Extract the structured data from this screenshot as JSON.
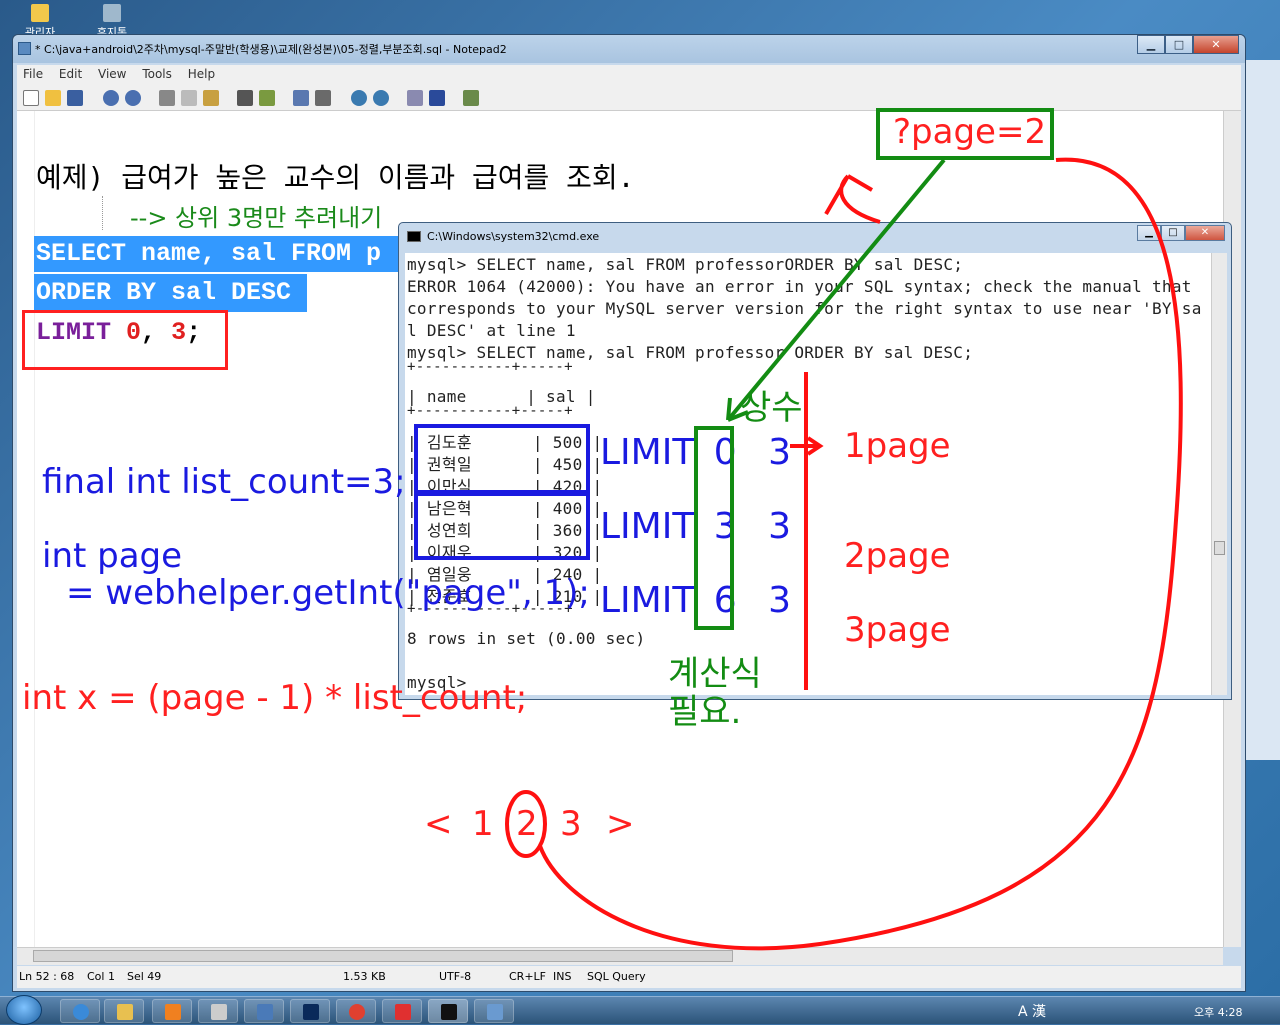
{
  "desktop": {
    "icons": [
      {
        "label": "관리자",
        "color": "#f2c84b"
      },
      {
        "label": "휴지통",
        "color": "#9fb8cc"
      }
    ]
  },
  "notepad": {
    "title": "* C:\\java+android\\2주차\\mysql-주말반(학생용)\\교제(완성본)\\05-정렬,부분조회.sql - Notepad2",
    "window_buttons": {
      "min": "▁",
      "max": "□",
      "close": "✕"
    },
    "menu": [
      "File",
      "Edit",
      "View",
      "Tools",
      "Help"
    ],
    "status": {
      "pos": "Ln 52 : 68",
      "col": "Col 1",
      "sel": "Sel 49",
      "size": "1.53 KB",
      "encoding": "UTF-8",
      "eol": "CR+LF",
      "ins": "INS",
      "scheme": "SQL Query"
    },
    "editor": {
      "line_example": "예제) 급여가 높은 교수의 이름과 급여를 조회.",
      "line_sub": "--> 상위 3명만 추려내기",
      "sql_line1": "SELECT name, sal FROM p",
      "sql_line2": "ORDER BY sal DESC",
      "limit_kw": "LIMIT",
      "limit_a": "0",
      "limit_comma": ",",
      "limit_b": "3",
      "limit_semi": ";"
    }
  },
  "cmd": {
    "title": "C:\\Windows\\system32\\cmd.exe",
    "buttons": {
      "min": "▁",
      "max": "□",
      "close": "✕"
    },
    "lines": [
      "mysql> SELECT name, sal FROM professorORDER BY sal DESC;",
      "ERROR 1064 (42000): You have an error in your SQL syntax; check the manual that",
      "corresponds to your MySQL server version for the right syntax to use near 'BY sa",
      "l DESC' at line 1",
      "mysql> SELECT name, sal FROM professor ORDER BY sal DESC;",
      "+-----------+-----+",
      "| name      | sal |",
      "+-----------+-----+"
    ],
    "rows": [
      {
        "name": "김도훈",
        "sal": "500"
      },
      {
        "name": "권혁일",
        "sal": "450"
      },
      {
        "name": "이만식",
        "sal": "420"
      },
      {
        "name": "남은혁",
        "sal": "400"
      },
      {
        "name": "성연희",
        "sal": "360"
      },
      {
        "name": "이재우",
        "sal": "320"
      },
      {
        "name": "염일웅",
        "sal": "240"
      },
      {
        "name": "전준호",
        "sal": "210"
      }
    ],
    "table_bottom": "+-----------+-----+",
    "result": "8 rows in set (0.00 sec)",
    "prompt": "mysql>"
  },
  "annotations": {
    "query_param": "?page=2",
    "list_count": "final int list_count=3;",
    "int_page": "int page",
    "get_int": "= webhelper.getInt(\"page\", 1);",
    "formula": "int x = (page - 1) * list_count;",
    "limit_word": "LIMIT",
    "offsets": [
      "0",
      "3",
      "6"
    ],
    "count": "3",
    "pages": [
      "1page",
      "2page",
      "3page"
    ],
    "constant": "상수",
    "calc_line1": "계산식",
    "calc_line2": "필요.",
    "pager_prev": "<",
    "pager_pages": [
      "1",
      "2",
      "3"
    ],
    "pager_next": ">"
  },
  "taskbar": {
    "ime": "A 漢",
    "clock": "오후 4:28"
  },
  "colors": {
    "annotation_red": "#ff2020",
    "annotation_blue": "#1a1ae0",
    "annotation_green": "#138c13",
    "selection": "#3399ff",
    "sql_purple": "#7a1f9a"
  }
}
